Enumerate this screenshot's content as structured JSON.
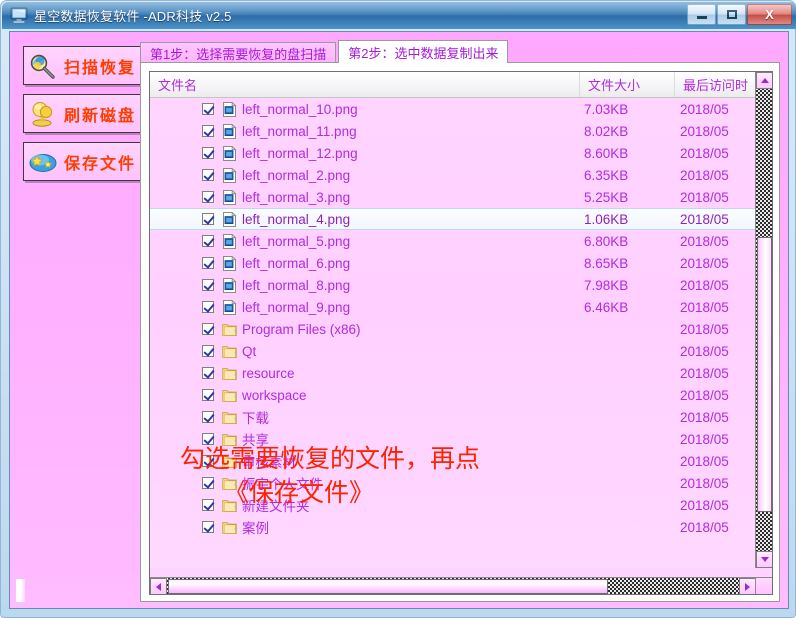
{
  "window": {
    "title": "星空数据恢复软件   -ADR科技 v2.5",
    "icon": "computer-monitor-icon",
    "controls": {
      "minimize": "–",
      "maximize": "□",
      "close": "X"
    }
  },
  "sidebar": {
    "buttons": [
      {
        "label": "扫描恢复",
        "icon": "magnifier-scan-icon"
      },
      {
        "label": "刷新磁盘",
        "icon": "refresh-disk-icon"
      },
      {
        "label": "保存文件",
        "icon": "save-star-icon"
      }
    ]
  },
  "tabs": [
    {
      "label": "第1步：选择需要恢复的盘扫描",
      "active": false
    },
    {
      "label": "第2步：选中数据复制出来",
      "active": true
    }
  ],
  "list": {
    "columns": [
      {
        "key": "name",
        "label": "文件名"
      },
      {
        "key": "size",
        "label": "文件大小"
      },
      {
        "key": "date",
        "label": "最后访问时"
      }
    ],
    "rows": [
      {
        "checked": true,
        "icon": "image-file-icon",
        "name": "left_normal_10.png",
        "size": "7.03KB",
        "date": "2018/05",
        "highlight": false
      },
      {
        "checked": true,
        "icon": "image-file-icon",
        "name": "left_normal_11.png",
        "size": "8.02KB",
        "date": "2018/05",
        "highlight": false
      },
      {
        "checked": true,
        "icon": "image-file-icon",
        "name": "left_normal_12.png",
        "size": "8.60KB",
        "date": "2018/05",
        "highlight": false
      },
      {
        "checked": true,
        "icon": "image-file-icon",
        "name": "left_normal_2.png",
        "size": "6.35KB",
        "date": "2018/05",
        "highlight": false
      },
      {
        "checked": true,
        "icon": "image-file-icon",
        "name": "left_normal_3.png",
        "size": "5.25KB",
        "date": "2018/05",
        "highlight": false
      },
      {
        "checked": true,
        "icon": "image-file-icon",
        "name": "left_normal_4.png",
        "size": "1.06KB",
        "date": "2018/05",
        "highlight": true
      },
      {
        "checked": true,
        "icon": "image-file-icon",
        "name": "left_normal_5.png",
        "size": "6.80KB",
        "date": "2018/05",
        "highlight": false
      },
      {
        "checked": true,
        "icon": "image-file-icon",
        "name": "left_normal_6.png",
        "size": "8.65KB",
        "date": "2018/05",
        "highlight": false
      },
      {
        "checked": true,
        "icon": "image-file-icon",
        "name": "left_normal_8.png",
        "size": "7.98KB",
        "date": "2018/05",
        "highlight": false
      },
      {
        "checked": true,
        "icon": "image-file-icon",
        "name": "left_normal_9.png",
        "size": "6.46KB",
        "date": "2018/05",
        "highlight": false
      },
      {
        "checked": true,
        "icon": "folder-icon",
        "name": "Program Files (x86)",
        "size": "",
        "date": "2018/05",
        "highlight": false
      },
      {
        "checked": true,
        "icon": "folder-icon",
        "name": "Qt",
        "size": "",
        "date": "2018/05",
        "highlight": false
      },
      {
        "checked": true,
        "icon": "folder-icon",
        "name": "resource",
        "size": "",
        "date": "2018/05",
        "highlight": false
      },
      {
        "checked": true,
        "icon": "folder-icon",
        "name": "workspace",
        "size": "",
        "date": "2018/05",
        "highlight": false
      },
      {
        "checked": true,
        "icon": "folder-icon",
        "name": "下载",
        "size": "",
        "date": "2018/05",
        "highlight": false
      },
      {
        "checked": true,
        "icon": "folder-icon",
        "name": "共享",
        "size": "",
        "date": "2018/05",
        "highlight": false
      },
      {
        "checked": true,
        "icon": "folder-icon",
        "name": "审核素材",
        "size": "",
        "date": "2018/05",
        "highlight": false
      },
      {
        "checked": true,
        "icon": "folder-icon",
        "name": "振宇个人文件",
        "size": "",
        "date": "2018/05",
        "highlight": false
      },
      {
        "checked": true,
        "icon": "folder-icon",
        "name": "新建文件夹",
        "size": "",
        "date": "2018/05",
        "highlight": false
      },
      {
        "checked": true,
        "icon": "folder-icon",
        "name": "案例",
        "size": "",
        "date": "2018/05",
        "highlight": false
      }
    ]
  },
  "annotation": {
    "line1": "勾选需要恢复的文件，再点",
    "line2": "《保存文件》"
  },
  "colors": {
    "client_pink": "#ffaaff",
    "list_pink": "#ffd3ff",
    "text_purple": "#b32ae0",
    "button_red": "#ff3d00",
    "annotation_red": "#ff2200",
    "titlebar_blue": "#3f84bf"
  }
}
